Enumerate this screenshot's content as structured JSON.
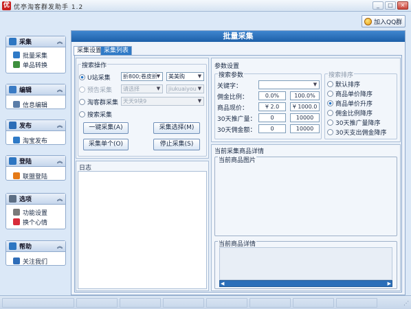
{
  "window": {
    "title": "优亭淘客群发助手 1.2",
    "icon_text": "优",
    "controls": [
      "_",
      "□",
      "×"
    ]
  },
  "top": {
    "qq_button": "加入QQ群"
  },
  "sidebar": [
    {
      "title": "采集",
      "color": "#2d76c2",
      "items": [
        {
          "label": "批量采集",
          "color": "#2f7ac7"
        },
        {
          "label": "单品转换",
          "color": "#3e8f3e"
        }
      ]
    },
    {
      "title": "编辑",
      "color": "#3a7bc4",
      "items": [
        {
          "label": "信息编辑",
          "color": "#5a7da8"
        }
      ]
    },
    {
      "title": "发布",
      "color": "#2c6db7",
      "items": [
        {
          "label": "淘宝发布",
          "color": "#2f7ac7"
        }
      ]
    },
    {
      "title": "登陆",
      "color": "#2d76c2",
      "items": [
        {
          "label": "联盟登陆",
          "color": "#e57a17"
        }
      ]
    },
    {
      "title": "选项",
      "color": "#5c6e84",
      "items": [
        {
          "label": "功能设置",
          "color": "#7a7a7a"
        },
        {
          "label": "换个心情",
          "color": "#d82c3a"
        }
      ]
    },
    {
      "title": "帮助",
      "color": "#2d76c2",
      "items": [
        {
          "label": "关注我们",
          "color": "#2f6db8"
        }
      ]
    }
  ],
  "main": {
    "title": "批量采集",
    "tabs": [
      "采集设置",
      "采集列表"
    ],
    "active_tab": 1,
    "search_ops": {
      "title": "搜索操作",
      "rows": [
        {
          "label": "U站采集",
          "selected": true,
          "enabled": true,
          "combo1": "折800;卷皮折",
          "combo2": "美美购"
        },
        {
          "label": "预告采集",
          "selected": false,
          "enabled": false,
          "combo1": "请选择",
          "combo2": "jiukuaiyou"
        },
        {
          "label": "淘客群采集",
          "selected": false,
          "enabled": true,
          "combo1": "天天9块9"
        },
        {
          "label": "搜索采集",
          "selected": false,
          "enabled": true
        }
      ],
      "buttons": [
        "一键采集(A)",
        "采集选择(M)",
        "采集单个(O)",
        "停止采集(S)"
      ]
    },
    "log": {
      "title": "日志"
    },
    "params": {
      "title": "参数设置",
      "search_params": {
        "title": "搜索参数",
        "fields": [
          {
            "label": "关键字：",
            "value": ""
          },
          {
            "label": "佣金比例：",
            "min": "0.0%",
            "max": "100.0%"
          },
          {
            "label": "商品现价：",
            "min": "¥ 2.0",
            "max": "¥ 1000.0"
          },
          {
            "label": "30天推广量：",
            "min": "0",
            "max": "10000"
          },
          {
            "label": "30天佣金额：",
            "min": "0",
            "max": "10000"
          }
        ]
      },
      "sort": {
        "title": "搜索排序",
        "options": [
          "默认排序",
          "商品单价降序",
          "商品单价升序",
          "佣金比例降序",
          "30天推广量降序",
          "30天支出佣金降序"
        ],
        "selected": 2
      }
    },
    "detail": {
      "title": "当前采集商品详情",
      "image_label": "当前商品图片",
      "detail_label": "当前商品详情"
    }
  },
  "colors": {
    "accent": "#2f7ac7",
    "title_bar_blue": "#1d5fa8",
    "qq_icon": "#e79d12"
  }
}
